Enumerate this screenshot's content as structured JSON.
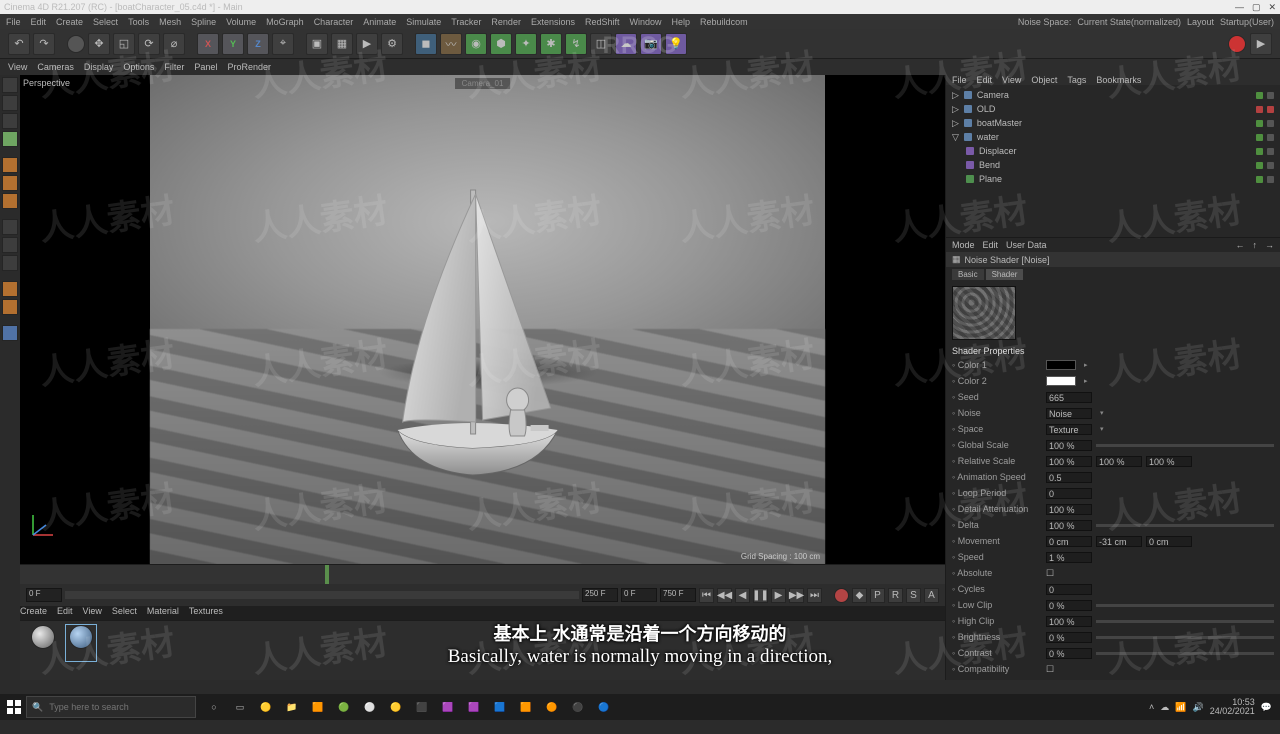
{
  "titlebar": {
    "text": "Cinema 4D R21.207 (RC) - [boatCharacter_05.c4d *] - Main"
  },
  "menubar": {
    "items": [
      "File",
      "Edit",
      "Create",
      "Select",
      "Tools",
      "Mesh",
      "Spline",
      "Volume",
      "MoGraph",
      "Character",
      "Animate",
      "Simulate",
      "Tracker",
      "Render",
      "Extensions",
      "RedShift",
      "Window",
      "Help",
      "Rebuildcom"
    ],
    "noise_space": "Noise Space:",
    "noise_value": "Current State(normalized)",
    "layout_lbl": "Layout",
    "layout_value": "Startup(User)"
  },
  "subbar": [
    "View",
    "Cameras",
    "Display",
    "Options",
    "Filter",
    "Panel",
    "ProRender"
  ],
  "viewport": {
    "label": "Perspective",
    "camera": "Camera_01",
    "grid": "Grid Spacing : 100 cm"
  },
  "timeline": {
    "start": "0 F",
    "current": "250 F",
    "end_a": "0 F",
    "end_b": "750 F"
  },
  "mat_menu": [
    "Create",
    "Edit",
    "View",
    "Select",
    "Material",
    "Textures"
  ],
  "objects": {
    "menu": [
      "File",
      "Edit",
      "View",
      "Object",
      "Tags",
      "Bookmarks"
    ],
    "rows": [
      {
        "n": "Camera",
        "i": "cam"
      },
      {
        "n": "OLD",
        "i": "null"
      },
      {
        "n": "boatMaster",
        "i": "null"
      },
      {
        "n": "water",
        "i": "null",
        "expand": true
      },
      {
        "n": "Displacer",
        "i": "deform",
        "indent": true
      },
      {
        "n": "Bend",
        "i": "deform",
        "indent": true
      },
      {
        "n": "Plane",
        "i": "poly",
        "indent": true
      }
    ]
  },
  "attr": {
    "menu": [
      "Mode",
      "Edit",
      "User Data"
    ],
    "subtitle": "Noise Shader [Noise]",
    "tabs": [
      "Basic",
      "Shader"
    ],
    "section": "Shader Properties",
    "rows": [
      {
        "l": "Color 1",
        "sw": "b"
      },
      {
        "l": "Color 2",
        "sw": "w"
      },
      {
        "l": "Seed",
        "v": "665"
      },
      {
        "l": "Noise",
        "v": "Noise",
        "dd": true
      },
      {
        "l": "Space",
        "v": "Texture",
        "dd": true
      },
      {
        "l": "Global Scale",
        "v": "100 %",
        "s": true
      },
      {
        "l": "Relative Scale",
        "v": "100 %",
        "v2": "100 %",
        "v3": "100 %"
      },
      {
        "l": "Animation Speed",
        "v": "0.5"
      },
      {
        "l": "Loop Period",
        "v": "0"
      },
      {
        "l": "Detail Attenuation",
        "v": "100 %"
      },
      {
        "l": "Delta",
        "v": "100 %",
        "s": true
      },
      {
        "l": "Movement",
        "v": "0 cm",
        "v2": "-31 cm",
        "v3": "0 cm"
      },
      {
        "l": "Speed",
        "v": "1 %"
      },
      {
        "l": "Absolute",
        "chk": true
      },
      {
        "l": "Cycles",
        "v": "0"
      },
      {
        "l": "Low Clip",
        "v": "0 %",
        "s": true
      },
      {
        "l": "High Clip",
        "v": "100 %",
        "s": true
      },
      {
        "l": "Brightness",
        "v": "0 %",
        "s": true
      },
      {
        "l": "Contrast",
        "v": "0 %",
        "s": true
      },
      {
        "l": "Compatibility",
        "chk": true
      }
    ]
  },
  "subtitle": {
    "cn": "基本上 水通常是沿着一个方向移动的",
    "en": "Basically, water is normally moving in a direction,"
  },
  "taskbar": {
    "search": "Type here to search",
    "clock": {
      "t": "10:53",
      "d": "24/02/2021"
    }
  },
  "wm": "人人素材",
  "rrcg": "RRCG"
}
